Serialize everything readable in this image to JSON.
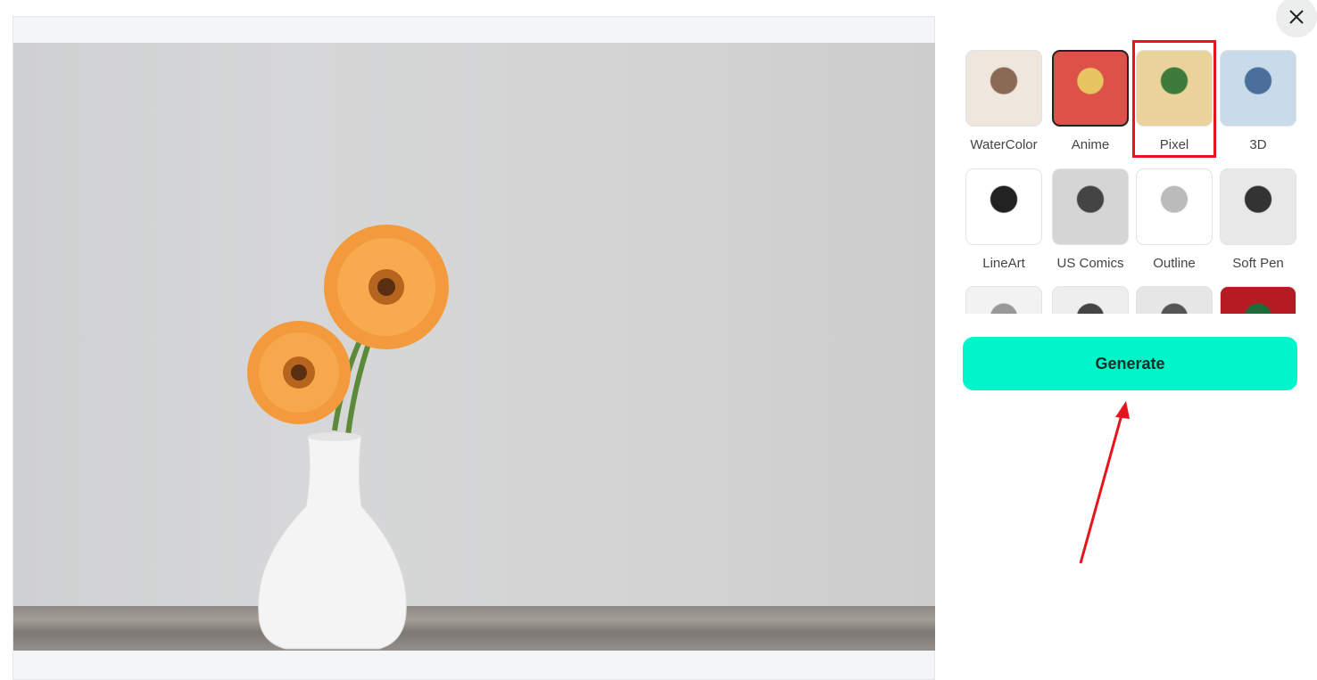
{
  "close_icon": "close-icon",
  "styles": [
    {
      "label": "WaterColor",
      "selected": false,
      "colors": [
        "#efe6de",
        "#8a6a55"
      ]
    },
    {
      "label": "Anime",
      "selected": true,
      "colors": [
        "#dd5148",
        "#e8c560"
      ]
    },
    {
      "label": "Pixel",
      "selected": false,
      "highlighted": true,
      "colors": [
        "#e9d39b",
        "#3e7a3c"
      ]
    },
    {
      "label": "3D",
      "selected": false,
      "colors": [
        "#c9dbe8",
        "#4a6f9c"
      ]
    },
    {
      "label": "LineArt",
      "selected": false,
      "colors": [
        "#ffffff",
        "#222222"
      ]
    },
    {
      "label": "US Comics",
      "selected": false,
      "colors": [
        "#d5d5d5",
        "#444444"
      ]
    },
    {
      "label": "Outline",
      "selected": false,
      "colors": [
        "#ffffff",
        "#bbbbbb"
      ]
    },
    {
      "label": "Soft Pen",
      "selected": false,
      "colors": [
        "#e8e8e8",
        "#333333"
      ]
    },
    {
      "label": "",
      "colors": [
        "#f2f2f2",
        "#999999"
      ]
    },
    {
      "label": "",
      "colors": [
        "#eeeeee",
        "#444444"
      ]
    },
    {
      "label": "",
      "colors": [
        "#e6e6e6",
        "#555555"
      ]
    },
    {
      "label": "",
      "colors": [
        "#b51b22",
        "#1e6b3a"
      ]
    }
  ],
  "generate_label": "Generate",
  "accent_color": "#00f5c8",
  "annotation_color": "#e8141c"
}
